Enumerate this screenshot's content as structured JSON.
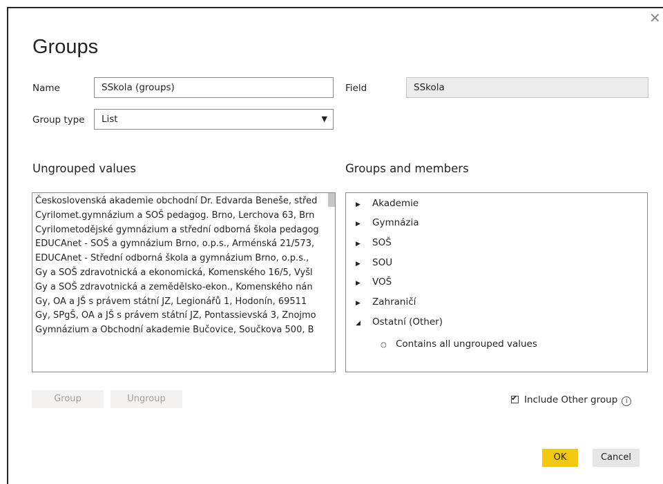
{
  "dialog": {
    "title": "Groups",
    "close_icon": "close-icon"
  },
  "form": {
    "name_label": "Name",
    "name_value": "SSkola (groups)",
    "field_label": "Field",
    "field_value": "SSkola",
    "group_type_label": "Group type",
    "group_type_value": "List"
  },
  "ungrouped": {
    "heading": "Ungrouped values",
    "items": [
      "Československá akademie obchodní Dr. Edvarda Beneše, střed",
      "Cyrilomet.gymnázium a SOŠ pedagog. Brno, Lerchova 63, Brn",
      "Cyrilometodějské gymnázium a střední odborná škola pedagog",
      "EDUCAnet - SOŠ a gymnázium Brno, o.p.s., Arménská 21/573,",
      "EDUCAnet - Střední odborná škola a gymnázium Brno, o.p.s.,",
      "Gy a SOŠ zdravotnická a ekonomická, Komenského 16/5, Vyšl",
      "Gy a SOŠ zdravotnická a zemědělsko-ekon., Komenského nán",
      "Gy, OA a JŠ s právem státní JZ, Legionářů 1, Hodonín, 69511",
      "Gy, SPgŠ, OA a JŠ s právem státní JZ, Pontassievská 3, Znojmo",
      "Gymnázium a Obchodní akademie Bučovice, Součkova 500, B"
    ]
  },
  "groups": {
    "heading": "Groups and members",
    "items": [
      {
        "label": "Akademie",
        "icon": "triangle-right-icon"
      },
      {
        "label": "Gymnázia",
        "icon": "triangle-right-icon"
      },
      {
        "label": "SOŠ",
        "icon": "triangle-right-icon"
      },
      {
        "label": "SOU",
        "icon": "triangle-right-icon"
      },
      {
        "label": "VOŠ",
        "icon": "triangle-right-icon"
      },
      {
        "label": "Zahraničí",
        "icon": "triangle-right-icon"
      },
      {
        "label": "Ostatní (Other)",
        "icon": "triangle-down-icon"
      }
    ],
    "other_member": "Contains all ungrouped values"
  },
  "buttons": {
    "group": "Group",
    "ungroup": "Ungroup",
    "ok": "OK",
    "cancel": "Cancel"
  },
  "include_other": {
    "label": "Include Other group",
    "checked": true,
    "info_icon": "i"
  },
  "colors": {
    "ok_accent": "#f2c811",
    "border": "#8a8886",
    "readonly_bg": "#ececec"
  }
}
